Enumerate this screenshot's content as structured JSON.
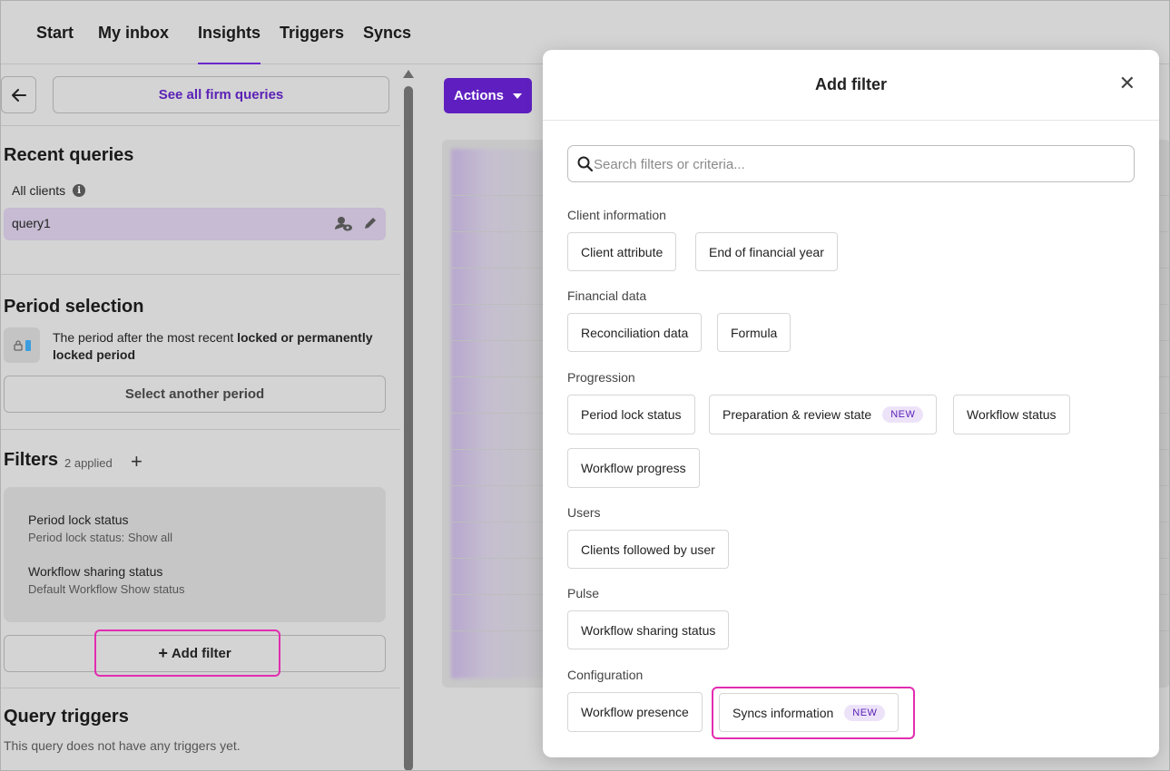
{
  "nav": {
    "tabs": [
      {
        "label": "Start"
      },
      {
        "label": "My inbox"
      },
      {
        "label": "Insights"
      },
      {
        "label": "Triggers"
      },
      {
        "label": "Syncs"
      }
    ]
  },
  "left": {
    "see_all_label": "See all firm queries",
    "recent_title": "Recent queries",
    "all_clients": "All clients",
    "query_name": "query1",
    "period_title": "Period selection",
    "period_text_1": "The period after the most recent ",
    "period_text_bold": "locked or permanently locked period",
    "select_period_label": "Select another period",
    "filters_title": "Filters",
    "filters_applied": "2 applied",
    "filters": [
      {
        "title": "Period lock status",
        "sub": "Period lock status: Show all"
      },
      {
        "title": "Workflow sharing status",
        "sub": "Default Workflow Show status"
      }
    ],
    "add_filter_label": "Add filter",
    "triggers_title": "Query triggers",
    "no_triggers": "This query does not have any triggers yet."
  },
  "toolbar": {
    "actions_label": "Actions"
  },
  "modal": {
    "title": "Add filter",
    "search_placeholder": "Search filters or criteria...",
    "categories": [
      {
        "label": "Client information",
        "chips": [
          "Client attribute",
          "End of financial year"
        ]
      },
      {
        "label": "Financial data",
        "chips": [
          "Reconciliation data",
          "Formula"
        ]
      },
      {
        "label": "Progression",
        "chips": [
          "Period lock status",
          "Preparation & review state",
          "Workflow status",
          "Workflow progress"
        ]
      },
      {
        "label": "Users",
        "chips": [
          "Clients followed by user"
        ]
      },
      {
        "label": "Pulse",
        "chips": [
          "Workflow sharing status"
        ]
      },
      {
        "label": "Configuration",
        "chips": [
          "Workflow presence",
          "Syncs information"
        ]
      }
    ],
    "new_badge": "NEW"
  },
  "colors": {
    "accent": "#5f1fc0",
    "highlight": "#e22db0"
  }
}
